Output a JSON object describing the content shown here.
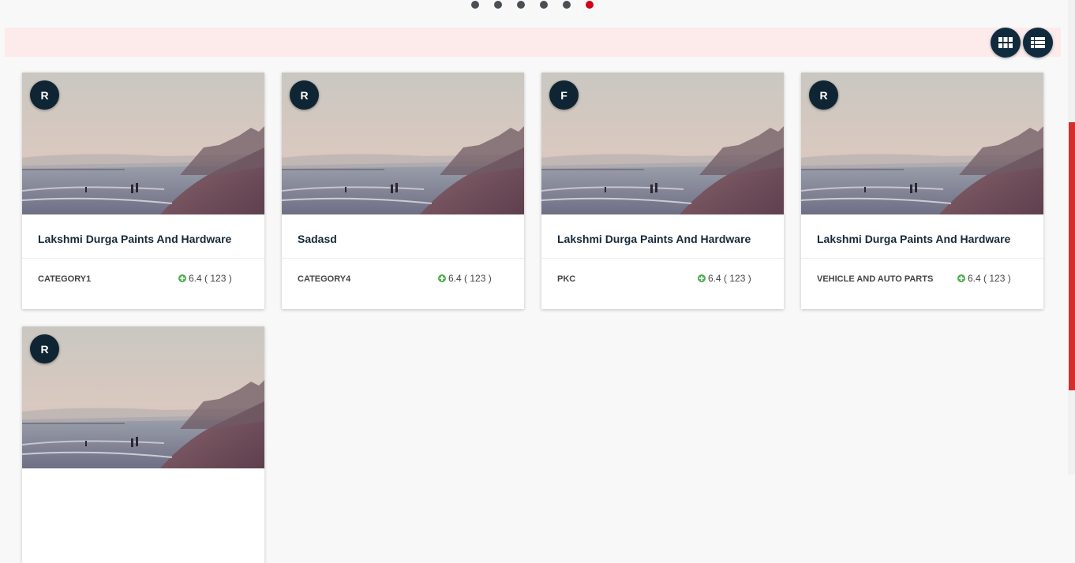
{
  "carousel": {
    "dot_count": 6,
    "active_index": 5
  },
  "colors": {
    "accent": "#d0021b",
    "badge_bg": "#0f2533",
    "filter_bar_bg": "#fdeaea",
    "rating_icon": "#4caf50"
  },
  "view_toggle": {
    "grid_icon": "grid-view-icon",
    "list_icon": "list-view-icon"
  },
  "listings": [
    {
      "initial": "R",
      "title": "Lakshmi Durga Paints And Hardware",
      "category": "CATEGORY1",
      "rating": "6.4 ( 123 )"
    },
    {
      "initial": "R",
      "title": "Sadasd",
      "category": "CATEGORY4",
      "rating": "6.4 ( 123 )"
    },
    {
      "initial": "F",
      "title": "Lakshmi Durga Paints And Hardware",
      "category": "PKC",
      "rating": "6.4 ( 123 )"
    },
    {
      "initial": "R",
      "title": "Lakshmi Durga Paints And Hardware",
      "category": "VEHICLE AND AUTO PARTS",
      "rating": "6.4 ( 123 )"
    },
    {
      "initial": "R",
      "title": "",
      "category": "",
      "rating": ""
    }
  ]
}
